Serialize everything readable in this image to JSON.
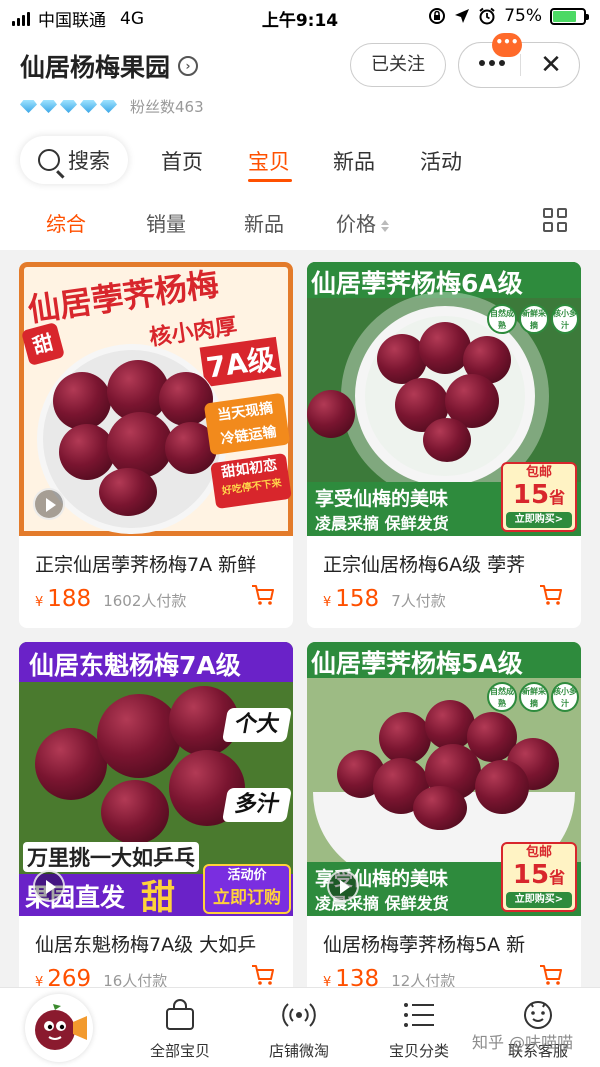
{
  "status_bar": {
    "carrier": "中国联通",
    "network": "4G",
    "time": "上午9:14",
    "battery_percent": "75%",
    "battery_level": 0.75
  },
  "shop": {
    "name": "仙居杨梅果园",
    "fans_label": "粉丝数463",
    "diamond_count": 5,
    "follow_label": "已关注",
    "message_badge": "•••"
  },
  "nav": {
    "search_label": "搜索",
    "tabs": [
      {
        "label": "首页",
        "active": false
      },
      {
        "label": "宝贝",
        "active": true
      },
      {
        "label": "新品",
        "active": false
      },
      {
        "label": "活动",
        "active": false
      }
    ]
  },
  "sort": {
    "items": [
      {
        "label": "综合",
        "active": true
      },
      {
        "label": "销量",
        "active": false
      },
      {
        "label": "新品",
        "active": false
      },
      {
        "label": "价格",
        "active": false
      }
    ]
  },
  "products": [
    {
      "title": "正宗仙居荸荠杨梅7A 新鲜",
      "currency": "¥",
      "price": "188",
      "sold": "1602人付款",
      "image": {
        "line1": "仙居荸荠杨梅",
        "line2": "核小肉厚",
        "grade": "7A级",
        "badge": "甜",
        "chip1a": "当天现摘",
        "chip1b": "冷链运输",
        "chip2a": "甜如初恋",
        "chip2b": "好吃停不下来"
      }
    },
    {
      "title": "正宗仙居杨梅6A级 荸荠",
      "currency": "¥",
      "price": "158",
      "sold": "7人付款",
      "image": {
        "line1": "仙居荸荠杨梅6A级",
        "tag1": "自然成熟",
        "tag2": "新鲜采摘",
        "tag3": "核小多汁",
        "slogan1": "享受仙梅的美味",
        "slogan2": "凌晨采摘  保鲜发货",
        "promo_top": "包邮",
        "promo_num": "15",
        "promo_unit": "省",
        "buy_now": "立即购买>"
      }
    },
    {
      "title": "仙居东魁杨梅7A级 大如乒",
      "currency": "¥",
      "price": "269",
      "sold": "16人付款",
      "image": {
        "line1": "仙居东魁杨梅7A级",
        "feat1": "个大",
        "feat2": "多汁",
        "band": "万里挑一大如乒乓",
        "bottom1": "果园直发",
        "badge": "甜",
        "promo1": "活动价",
        "promo2": "立即订购"
      }
    },
    {
      "title": "仙居杨梅荸荠杨梅5A 新",
      "currency": "¥",
      "price": "138",
      "sold": "12人付款",
      "image": {
        "line1": "仙居荸荠杨梅5A级",
        "tag1": "自然成熟",
        "tag2": "新鲜采摘",
        "tag3": "核小多汁",
        "slogan1": "享受仙梅的美味",
        "slogan2": "凌晨采摘  保鲜发货",
        "promo_top": "包邮",
        "promo_num": "15",
        "promo_unit": "省",
        "buy_now": "立即购买>"
      }
    }
  ],
  "bottom_bar": {
    "items": [
      {
        "label": "全部宝贝",
        "icon": "shopping-bag-icon"
      },
      {
        "label": "店铺微淘",
        "icon": "broadcast-icon"
      },
      {
        "label": "宝贝分类",
        "icon": "list-icon"
      },
      {
        "label": "联系客服",
        "icon": "customer-service-icon"
      }
    ]
  },
  "watermark": "知乎 @呋喵喵",
  "colors": {
    "accent": "#ff5000",
    "banner_red": "#d8262c",
    "banner_green": "#2e8b3d",
    "banner_purple": "#6a22c8"
  }
}
